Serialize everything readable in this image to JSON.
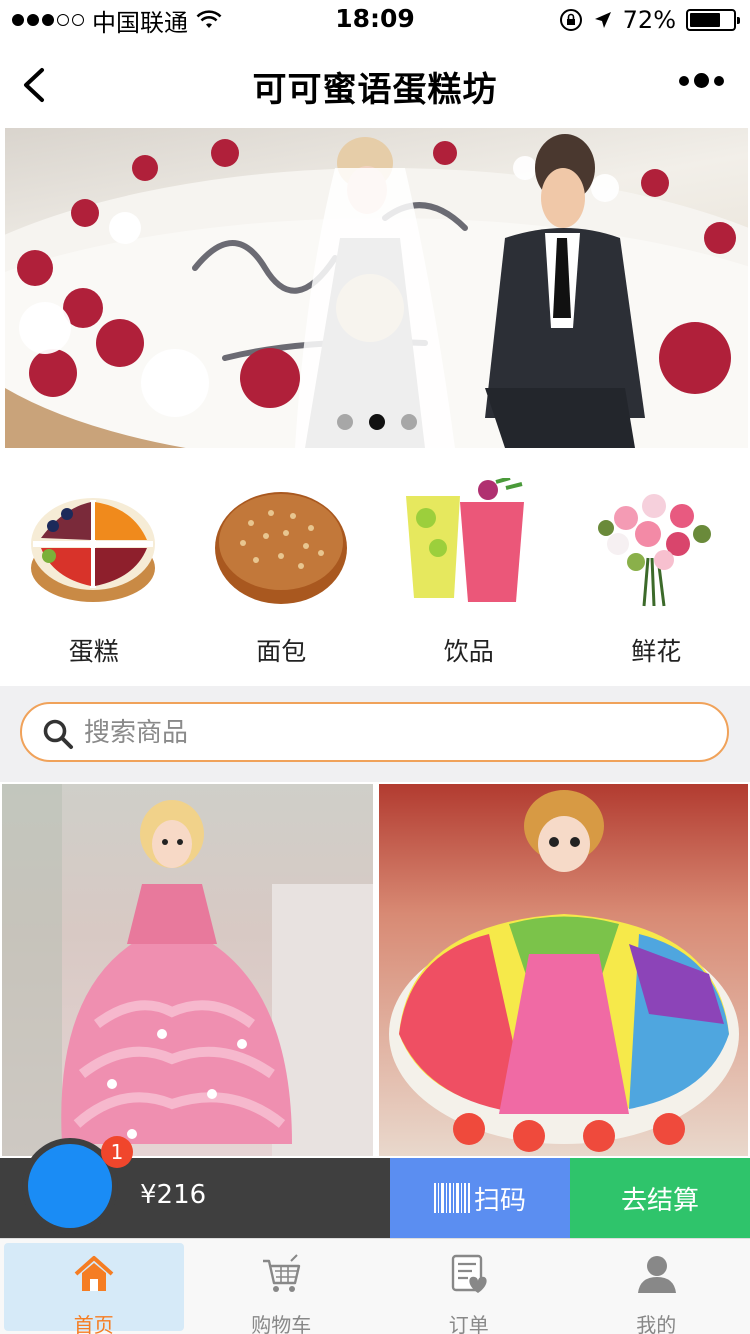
{
  "status_bar": {
    "carrier": "中国联通",
    "time": "18:09",
    "battery_percent": "72%",
    "battery_level": 0.72,
    "signal_bars_filled": 3,
    "signal_bars_total": 5
  },
  "nav": {
    "title": "可可蜜语蛋糕坊"
  },
  "banner": {
    "slide_count": 3,
    "active_slide": 2
  },
  "categories": [
    {
      "label": "蛋糕",
      "icon": "cake-icon"
    },
    {
      "label": "面包",
      "icon": "bread-icon"
    },
    {
      "label": "饮品",
      "icon": "drink-icon"
    },
    {
      "label": "鲜花",
      "icon": "flower-icon"
    }
  ],
  "search": {
    "placeholder": "搜索商品"
  },
  "cart": {
    "badge_count": "1",
    "total_price": "¥216",
    "scan_label": "扫码",
    "checkout_label": "去结算"
  },
  "tabs": [
    {
      "label": "首页",
      "icon": "home-icon",
      "active": true
    },
    {
      "label": "购物车",
      "icon": "cart-icon",
      "active": false
    },
    {
      "label": "订单",
      "icon": "order-icon",
      "active": false
    },
    {
      "label": "我的",
      "icon": "user-icon",
      "active": false
    }
  ],
  "colors": {
    "accent_orange": "#f57d23",
    "search_border": "#f0a25a",
    "cart_blue": "#1a8cf5",
    "scan_blue": "#5b8ef1",
    "checkout_green": "#2fc46b",
    "badge_red": "#f0462c",
    "cart_bar_dark": "#3f3f3f",
    "active_tab_bg": "#d6eaf8"
  }
}
